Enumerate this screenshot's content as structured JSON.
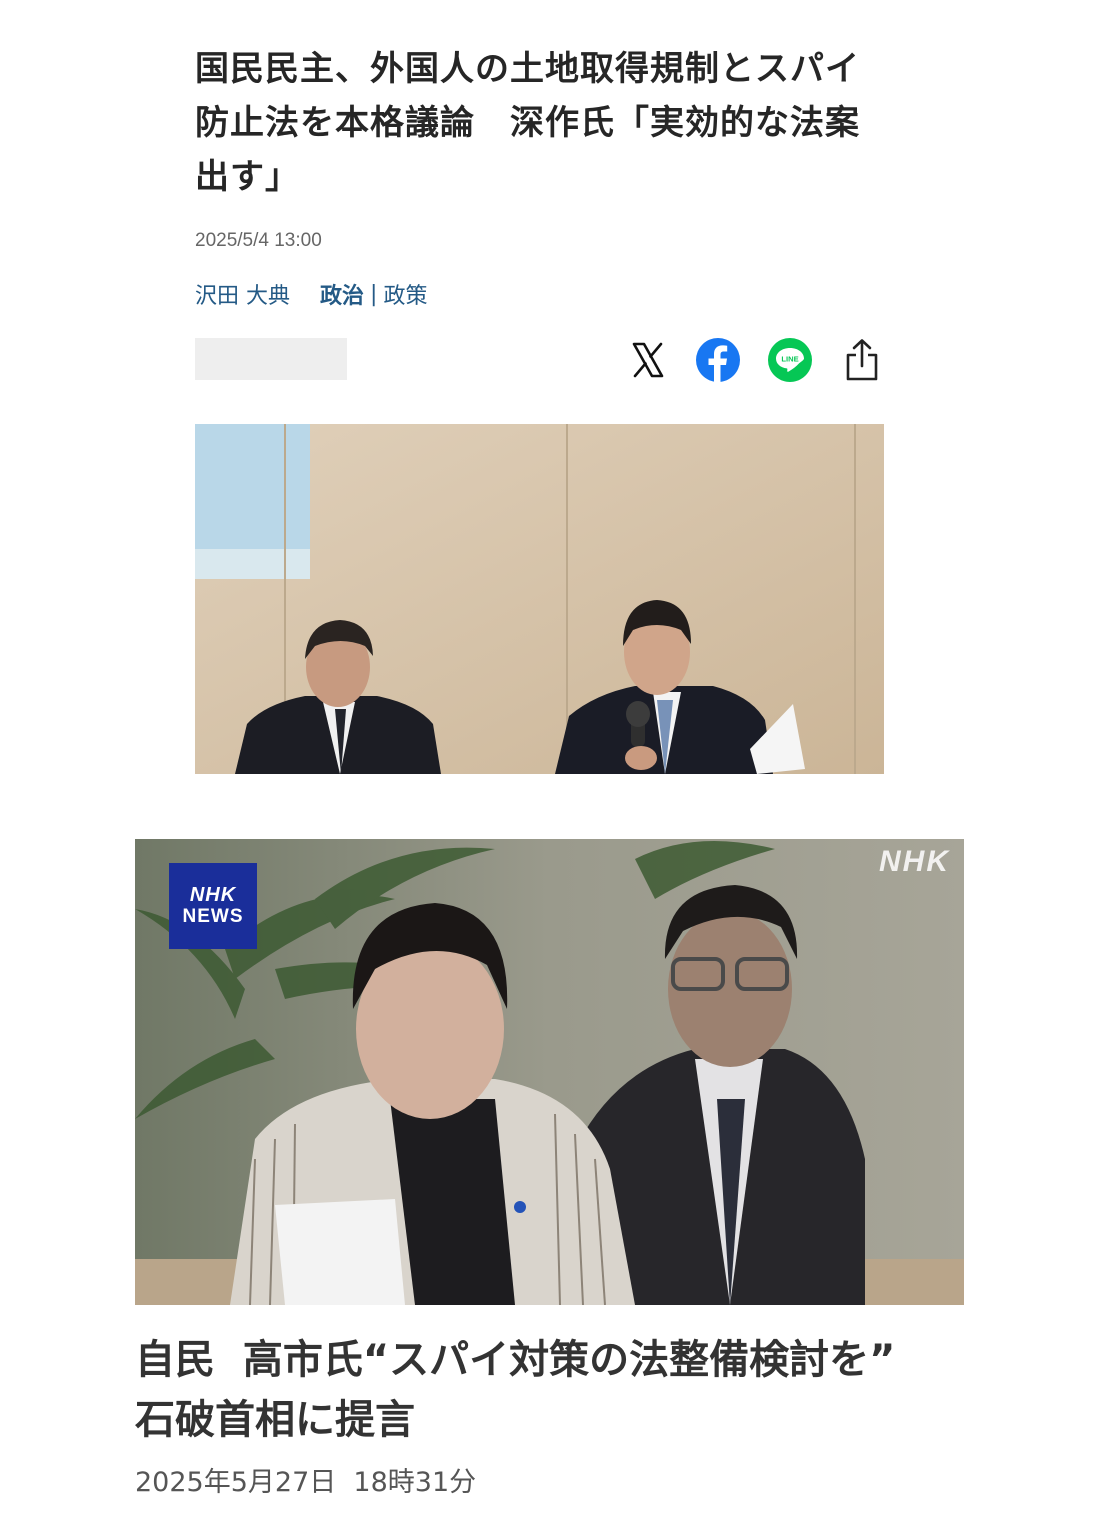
{
  "article1": {
    "title_lines": [
      "国民民主、外国人の土地取得規制とスパイ",
      "防止法を本格議論　深作氏「実効的な法案",
      "出す」"
    ],
    "timestamp": "2025/5/4 13:00",
    "author": "沢田 大典",
    "category_main": "政治",
    "category_separator": "|",
    "category_sub": "政策",
    "share_icons": [
      "x-icon",
      "facebook-icon",
      "line-icon",
      "share-upload-icon"
    ],
    "line_icon_text": "LINE"
  },
  "article2": {
    "badge_line1": "NHK",
    "badge_line2": "NEWS",
    "watermark": "NHK",
    "title_lines": [
      "自民  高市氏“スパイ対策の法整備検討を”",
      "石破首相に提言"
    ],
    "timestamp": "2025年5月27日  18時31分"
  },
  "colors": {
    "link_blue": "#245a86",
    "facebook_blue": "#1877f2",
    "line_green": "#06c755",
    "nhk_blue": "#1a2e9a"
  }
}
